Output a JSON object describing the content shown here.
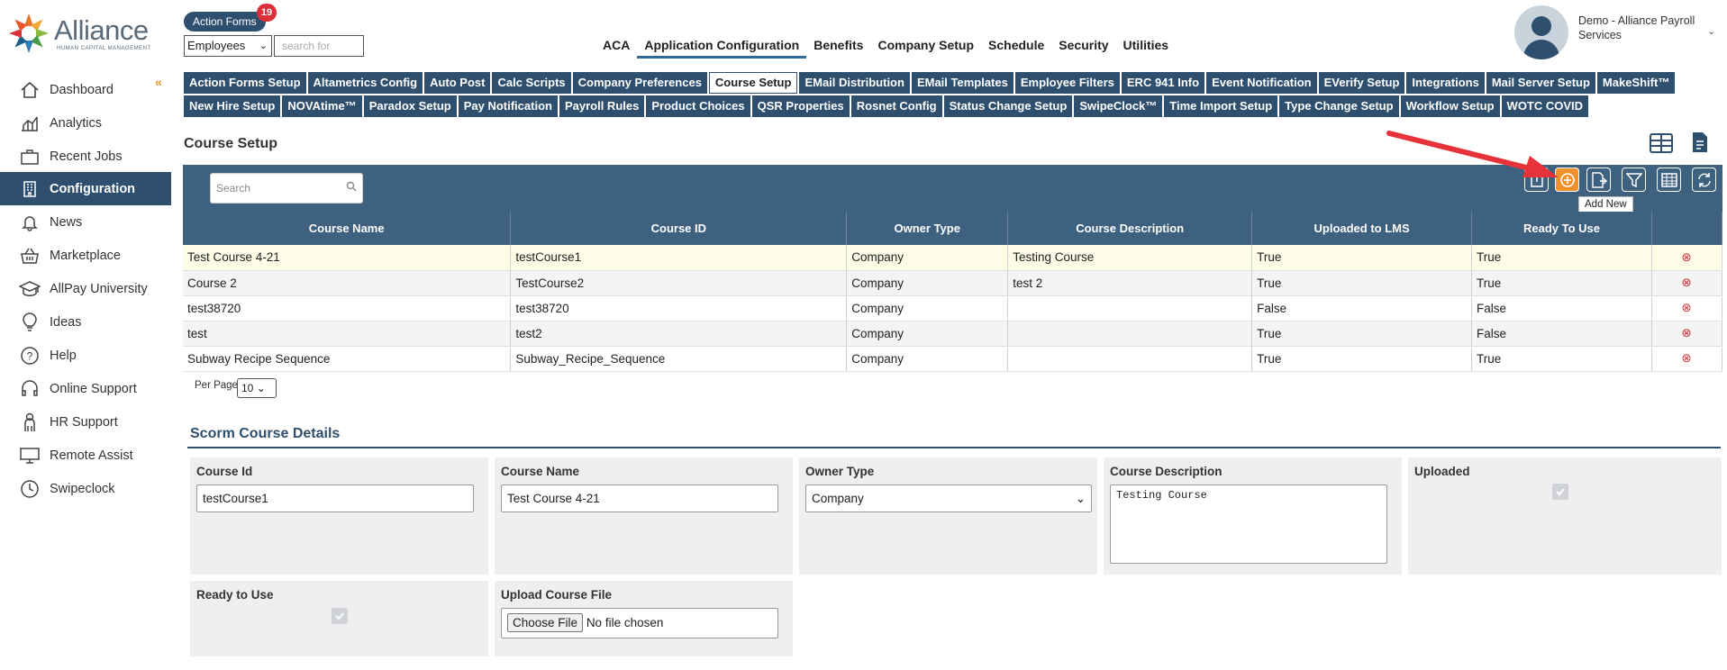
{
  "brand": {
    "name": "Alliance",
    "tagline": "HUMAN CAPITAL MANAGEMENT"
  },
  "header": {
    "action_forms": {
      "label": "Action Forms",
      "badge": "19"
    },
    "employee_select": "Employees",
    "search_placeholder": "search for",
    "nav": [
      "ACA",
      "Application Configuration",
      "Benefits",
      "Company Setup",
      "Schedule",
      "Security",
      "Utilities"
    ],
    "active_nav": "Application Configuration",
    "user": "Demo - Alliance Payroll Services"
  },
  "sidebar": {
    "items": [
      {
        "label": "Dashboard",
        "icon": "home-icon"
      },
      {
        "label": "Analytics",
        "icon": "analytics-icon"
      },
      {
        "label": "Recent Jobs",
        "icon": "briefcase-icon"
      },
      {
        "label": "Configuration",
        "icon": "building-icon",
        "active": true
      },
      {
        "label": "News",
        "icon": "bell-icon"
      },
      {
        "label": "Marketplace",
        "icon": "basket-icon"
      },
      {
        "label": "AllPay University",
        "icon": "graduation-cap-icon"
      },
      {
        "label": "Ideas",
        "icon": "lightbulb-icon"
      },
      {
        "label": "Help",
        "icon": "help-icon"
      },
      {
        "label": "Online Support",
        "icon": "headset-icon"
      },
      {
        "label": "HR Support",
        "icon": "person-icon"
      },
      {
        "label": "Remote Assist",
        "icon": "monitor-icon"
      },
      {
        "label": "Swipeclock",
        "icon": "clock-icon"
      }
    ]
  },
  "tabs": {
    "row1": [
      "Action Forms Setup",
      "Altametrics Config",
      "Auto Post",
      "Calc Scripts",
      "Company Preferences",
      "Course Setup",
      "EMail Distribution",
      "EMail Templates",
      "Employee Filters",
      "ERC 941 Info",
      "Event Notification",
      "EVerify Setup",
      "Integrations",
      "Mail Server Setup",
      "MakeShift™"
    ],
    "row2": [
      "New Hire Setup",
      "NOVAtime™",
      "Paradox Setup",
      "Pay Notification",
      "Payroll Rules",
      "Product Choices",
      "QSR Properties",
      "Rosnet Config",
      "Status Change Setup",
      "SwipeClock™",
      "Time Import Setup",
      "Type Change Setup",
      "Workflow Setup",
      "WOTC COVID"
    ],
    "active": "Course Setup"
  },
  "page": {
    "title": "Course Setup",
    "search_placeholder": "Search",
    "tooltip": "Add New"
  },
  "table": {
    "columns": [
      "Course Name",
      "Course ID",
      "Owner Type",
      "Course Description",
      "Uploaded to LMS",
      "Ready To Use"
    ],
    "rows": [
      [
        "Test Course 4-21",
        "testCourse1",
        "Company",
        "Testing Course",
        "True",
        "True"
      ],
      [
        "Course 2",
        "TestCourse2",
        "Company",
        "test 2",
        "True",
        "True"
      ],
      [
        "test38720",
        "test38720",
        "Company",
        "",
        "False",
        "False"
      ],
      [
        "test",
        "test2",
        "Company",
        "",
        "True",
        "False"
      ],
      [
        "Subway Recipe Sequence",
        "Subway_Recipe_Sequence",
        "Company",
        "",
        "True",
        "True"
      ]
    ],
    "per_page_label": "Per Page",
    "per_page_value": "10"
  },
  "details": {
    "title": "Scorm Course Details",
    "course_id_label": "Course Id",
    "course_id_value": "testCourse1",
    "course_name_label": "Course Name",
    "course_name_value": "Test Course 4-21",
    "owner_type_label": "Owner Type",
    "owner_type_value": "Company",
    "course_desc_label": "Course Description",
    "course_desc_value": "Testing Course",
    "uploaded_label": "Uploaded",
    "ready_label": "Ready to Use",
    "upload_label": "Upload Course File",
    "choose_file": "Choose File",
    "no_file": "No file chosen"
  },
  "colors": {
    "navy": "#2f4f6f",
    "toolbar": "#3f6180",
    "accent": "#f1912c",
    "delete": "#d9303a"
  }
}
